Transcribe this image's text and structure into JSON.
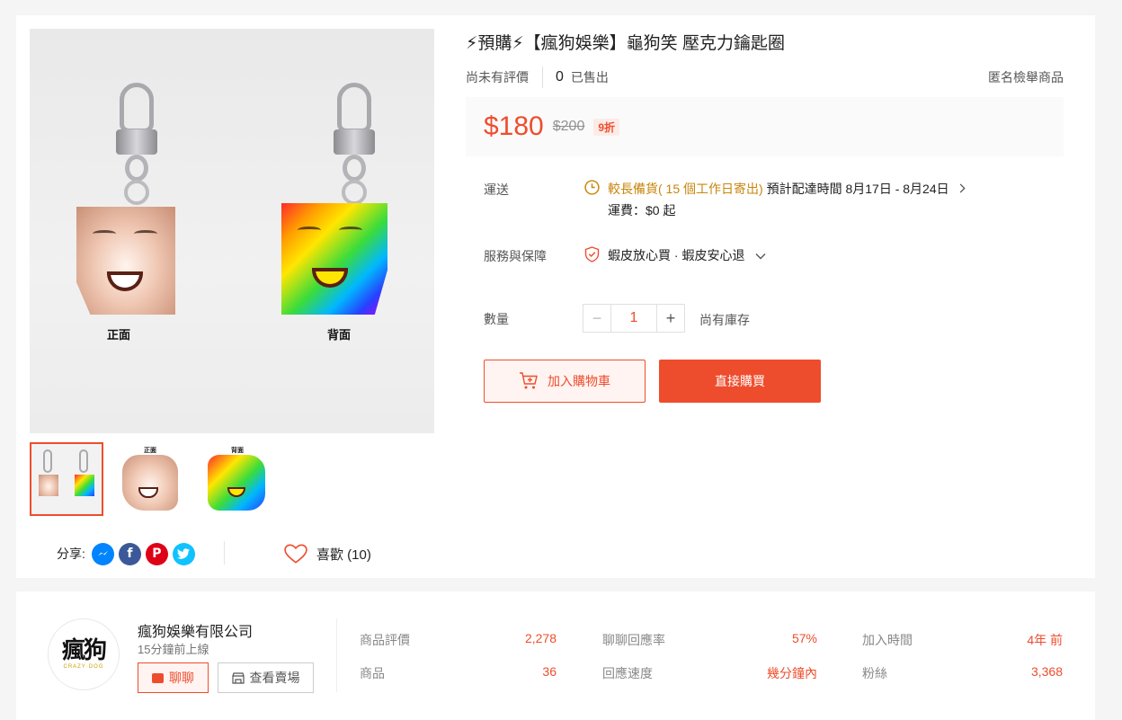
{
  "product": {
    "title": "⚡預購⚡【瘋狗娛樂】龜狗笑 壓克力鑰匙圈",
    "rating_text": "尚未有評價",
    "sold_count": "0",
    "sold_label": "已售出",
    "report_label": "匿名檢舉商品",
    "price": "$180",
    "original_price": "$200",
    "discount": "9折",
    "image_captions": {
      "front": "正面",
      "back": "背面"
    },
    "shipping": {
      "label": "運送",
      "longer_prep": "較長備貨( 15 個工作日寄出)",
      "estimate": "預計配達時間 8月17日 - 8月24日",
      "fee": "運費：$0 起"
    },
    "guarantee": {
      "label": "服務與保障",
      "text": "蝦皮放心買 · 蝦皮安心退"
    },
    "quantity": {
      "label": "數量",
      "value": "1",
      "minus": "−",
      "plus": "+",
      "stock": "尚有庫存"
    },
    "add_to_cart": "加入購物車",
    "buy_now": "直接購買",
    "share_label": "分享:",
    "like_label": "喜歡 (10)"
  },
  "icons": {
    "clock": "clock-icon",
    "shield": "shield-icon",
    "cart": "cart-plus-icon",
    "heart": "heart-icon",
    "store": "store-icon",
    "chat": "chat-icon"
  },
  "colors": {
    "accent": "#ee4d2d",
    "prep_orange": "#c8860c"
  },
  "shop": {
    "logo_text": "瘋狗",
    "logo_sub": "CRAZY·DOG",
    "name": "瘋狗娛樂有限公司",
    "online": "15分鐘前上線",
    "chat_button": "聊聊",
    "view_shop_button": "查看賣場",
    "stats": [
      {
        "label": "商品評價",
        "value": "2,278"
      },
      {
        "label": "聊聊回應率",
        "value": "57%"
      },
      {
        "label": "加入時間",
        "value": "4年 前"
      },
      {
        "label": "商品",
        "value": "36"
      },
      {
        "label": "回應速度",
        "value": "幾分鐘內"
      },
      {
        "label": "粉絲",
        "value": "3,368"
      }
    ]
  }
}
